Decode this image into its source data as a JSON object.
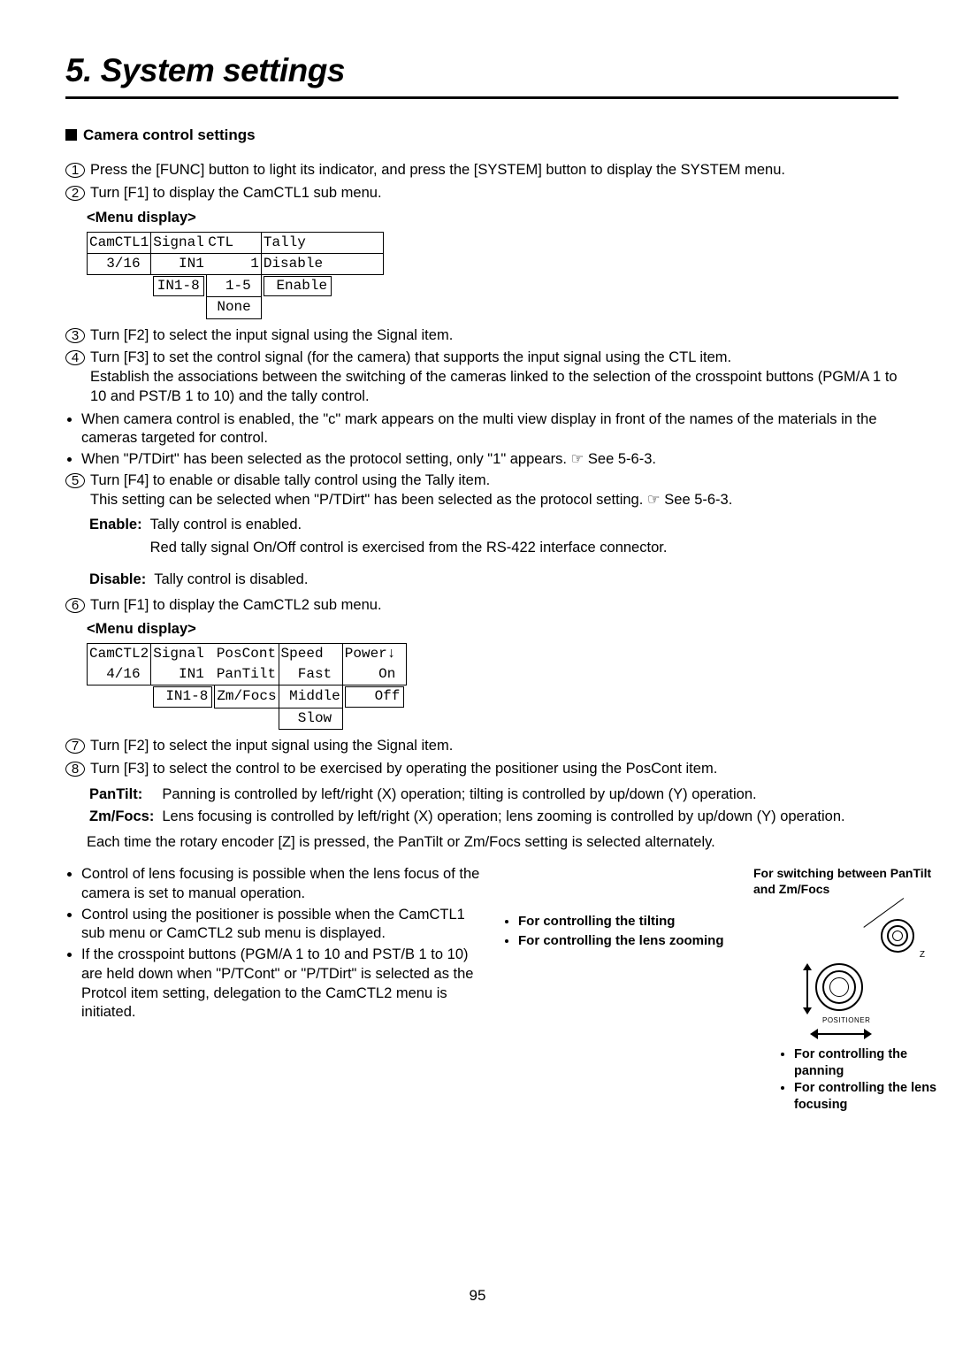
{
  "title": "5. System settings",
  "section": "Camera control settings",
  "steps": {
    "s1": "Press the [FUNC] button to light its indicator, and press the [SYSTEM] button to display the SYSTEM menu.",
    "s2": "Turn [F1] to display the CamCTL1 sub menu.",
    "s3": "Turn [F2] to select the input signal using the Signal item.",
    "s4a": "Turn [F3] to set the control signal (for the camera) that supports the input signal using the CTL item.",
    "s4b": "Establish the associations between the switching of the cameras linked to the selection of the crosspoint buttons (PGM/A 1 to 10 and PST/B 1 to 10) and the tally control.",
    "s4_b1": "When camera control is enabled, the \"c\" mark appears on the multi view display in front of the names of the materials in the cameras targeted for control.",
    "s4_b2": "When \"P/TDirt\" has been selected as the protocol setting, only \"1\" appears.  ☞ See 5-6-3.",
    "s5a": "Turn [F4] to enable or disable tally control using the Tally item.",
    "s5b": "This setting can be selected when \"P/TDirt\" has been selected as the protocol setting.  ☞ See 5-6-3.",
    "s5_enable_lbl": "Enable:",
    "s5_enable_txt": "Tally control is enabled.",
    "s5_enable_txt2": "Red tally signal On/Off control is exercised from the RS-422 interface connector.",
    "s5_disable_lbl": "Disable:",
    "s5_disable_txt": "Tally control is disabled.",
    "s6": "Turn [F1] to display the CamCTL2 sub menu.",
    "s7": "Turn [F2] to select the input signal using the Signal item.",
    "s8a": "Turn [F3] to select the control to be exercised by operating the positioner using the PosCont item.",
    "s8_pt_lbl": "PanTilt:",
    "s8_pt_txt": "Panning is controlled by left/right (X) operation; tilting is controlled by up/down (Y) operation.",
    "s8_zf_lbl": "Zm/Focs:",
    "s8_zf_txt": "Lens focusing is controlled by left/right (X) operation; lens zooming is controlled by up/down (Y) operation.",
    "s8_tail": "Each time the rotary encoder [Z] is pressed, the PanTilt or Zm/Focs setting is selected alternately."
  },
  "menu_label": "<Menu display>",
  "menu1": {
    "r1c1": "CamCTL1",
    "r1c2": "Signal",
    "r1c3": "CTL",
    "r1c4": "Tally",
    "r1c5": "",
    "r2c1": "  3/16",
    "r2c2": "   IN1",
    "r2c3": "     1",
    "r2c4": "Disable",
    "r3c2": "IN1-8",
    "r3c3": "  1-5",
    "r3c4": " Enable",
    "r4c3": " None"
  },
  "menu2": {
    "r1c1": "CamCTL2",
    "r1c2": "Signal",
    "r1c3": "PosCont",
    "r1c4": "Speed",
    "r1c5": "Power↓",
    "r2c1": "  4/16",
    "r2c2": "   IN1",
    "r2c3": "PanTilt",
    "r2c4": "  Fast",
    "r2c5": "    On",
    "r3c2": " IN1-8",
    "r3c3": "Zm/Focs",
    "r3c4": " Middle",
    "r3c5": "   Off",
    "r4c4": "  Slow"
  },
  "notes": {
    "n1": "Control of lens focusing is possible when the lens focus of the camera is set to manual operation.",
    "n2": "Control using the positioner is possible when the CamCTL1 sub menu or CamCTL2 sub menu is displayed.",
    "n3": "If the crosspoint buttons (PGM/A 1 to 10 and PST/B 1 to 10) are held down when \"P/TCont\" or \"P/TDirt\" is selected as the Protcol item setting, delegation to the CamCTL2 menu is initiated."
  },
  "mid": {
    "m1": "For controlling the tilting",
    "m2": "For controlling the lens zooming"
  },
  "right": {
    "cap": "For switching between PanTilt and Zm/Focs",
    "pos": "POSITIONER",
    "z": "Z",
    "b1": "For controlling the panning",
    "b2": "For controlling the lens focusing"
  },
  "page_number": "95"
}
